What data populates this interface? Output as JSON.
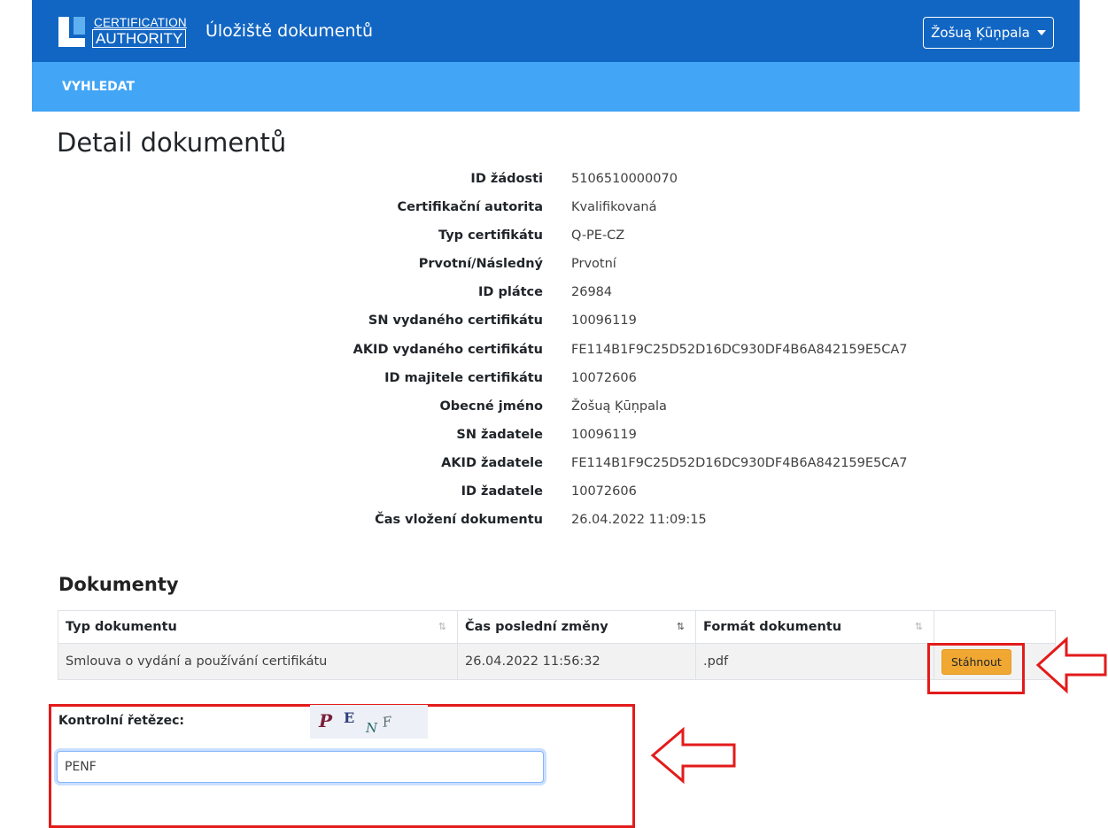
{
  "header": {
    "logo_line1": "CERTIFICATION",
    "logo_line2": "AUTHORITY",
    "app_title": "Úložiště dokumentů",
    "user_name": "Žošuą Ķūņpala"
  },
  "nav": {
    "search": "VYHLEDAT"
  },
  "page": {
    "title": "Detail dokumentů"
  },
  "details": [
    {
      "label": "ID žádosti",
      "value": "5106510000070"
    },
    {
      "label": "Certifikační autorita",
      "value": "Kvalifikovaná"
    },
    {
      "label": "Typ certifikátu",
      "value": "Q-PE-CZ"
    },
    {
      "label": "Prvotní/Následný",
      "value": "Prvotní"
    },
    {
      "label": "ID plátce",
      "value": "26984"
    },
    {
      "label": "SN vydaného certifikátu",
      "value": "10096119"
    },
    {
      "label": "AKID vydaného certifikátu",
      "value": "FE114B1F9C25D52D16DC930DF4B6A842159E5CA7"
    },
    {
      "label": "ID majitele certifikátu",
      "value": "10072606"
    },
    {
      "label": "Obecné jméno",
      "value": "Žošuą Ķūņpala"
    },
    {
      "label": "SN žadatele",
      "value": "10096119"
    },
    {
      "label": "AKID žadatele",
      "value": "FE114B1F9C25D52D16DC930DF4B6A842159E5CA7"
    },
    {
      "label": "ID žadatele",
      "value": "10072606"
    },
    {
      "label": "Čas vložení dokumentu",
      "value": "26.04.2022 11:09:15"
    }
  ],
  "documents": {
    "title": "Dokumenty",
    "columns": [
      "Typ dokumentu",
      "Čas poslední změny",
      "Formát dokumentu"
    ],
    "rows": [
      {
        "type": "Smlouva o vydání a používání certifikátu",
        "modified": "26.04.2022 11:56:32",
        "format": ".pdf",
        "action": "Stáhnout"
      }
    ]
  },
  "captcha": {
    "label": "Kontrolní řetězec:",
    "image_text": "PENF",
    "input_value": "PENF"
  },
  "colors": {
    "topbar": "#1266c3",
    "navbar": "#42a5f5",
    "download_button": "#f0a832",
    "annotation": "#e31b1b"
  }
}
